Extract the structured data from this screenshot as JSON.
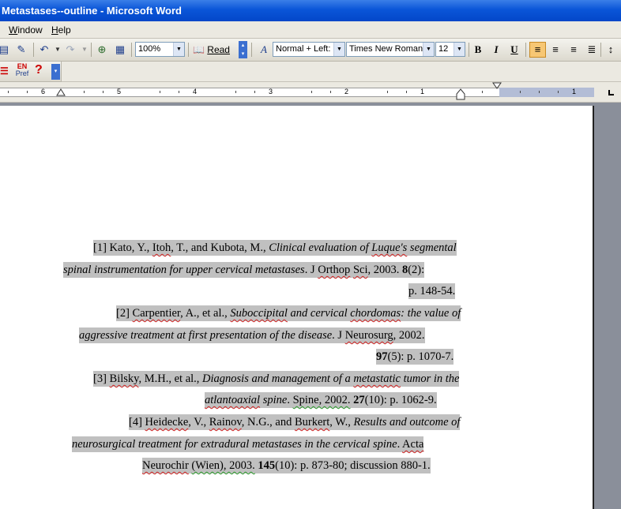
{
  "window": {
    "title": "Metastases--outline - Microsoft Word"
  },
  "menu": {
    "items": [
      "Window",
      "Help"
    ],
    "accel": [
      "W",
      "H"
    ]
  },
  "toolbar": {
    "zoom": "100%",
    "read_label": "Read",
    "style": "Normal + Left:",
    "font": "Times New Roman",
    "size": "12",
    "bold": "B",
    "italic": "I",
    "underline": "U"
  },
  "toolbar2": {
    "lang_top": "EN",
    "lang_bottom": "Pref",
    "help": "?"
  },
  "ruler": {
    "numbers": [
      "6",
      "5",
      "4",
      "3",
      "2",
      "1",
      "1"
    ]
  },
  "references": [
    {
      "lines": [
        [
          {
            "t": "[1] Kato, Y., "
          },
          {
            "t": "Itoh",
            "s": "wavy"
          },
          {
            "t": ", T., and Kubota, M., "
          },
          {
            "t": "Clinical evaluation of ",
            "i": true
          },
          {
            "t": "Luque's",
            "i": true,
            "s": "wavy"
          },
          {
            "t": " segmental",
            "i": true
          }
        ],
        [
          {
            "t": "spinal instrumentation for upper cervical metastases",
            "i": true
          },
          {
            "t": ". J "
          },
          {
            "t": "Orthop",
            "s": "wavy"
          },
          {
            "t": " "
          },
          {
            "t": "Sci",
            "s": "wavy"
          },
          {
            "t": ", 2003. "
          },
          {
            "t": "8",
            "b": true
          },
          {
            "t": "(2):"
          }
        ],
        [
          {
            "t": "p. 148-54."
          }
        ]
      ]
    },
    {
      "lines": [
        [
          {
            "t": "[2] "
          },
          {
            "t": "Carpentier",
            "s": "wavy"
          },
          {
            "t": ", A., et al., "
          },
          {
            "t": "Suboccipital",
            "i": true,
            "s": "wavy"
          },
          {
            "t": " and cervical ",
            "i": true
          },
          {
            "t": "chordomas",
            "i": true,
            "s": "wavy"
          },
          {
            "t": ": the value of",
            "i": true
          }
        ],
        [
          {
            "t": "aggressive treatment at first presentation of the disease",
            "i": true
          },
          {
            "t": ". J "
          },
          {
            "t": "Neurosurg",
            "s": "wavy"
          },
          {
            "t": ", 2002."
          }
        ],
        [
          {
            "t": "97",
            "b": true
          },
          {
            "t": "(5): p. 1070-7."
          }
        ]
      ]
    },
    {
      "lines": [
        [
          {
            "t": "[3] "
          },
          {
            "t": "Bilsky",
            "s": "wavy"
          },
          {
            "t": ", M.H., et al., "
          },
          {
            "t": "Diagnosis and management of a ",
            "i": true
          },
          {
            "t": "metastatic",
            "i": true,
            "s": "wavy"
          },
          {
            "t": " tumor in the",
            "i": true
          }
        ],
        [
          {
            "t": "atlantoaxial",
            "i": true,
            "s": "wavy"
          },
          {
            "t": " spine",
            "i": true
          },
          {
            "t": ". "
          },
          {
            "t": "Spine, 2002.",
            "s": "wavyg"
          },
          {
            "t": " "
          },
          {
            "t": "27",
            "b": true
          },
          {
            "t": "(10): p. 1062-9."
          }
        ]
      ]
    },
    {
      "lines": [
        [
          {
            "t": "[4] "
          },
          {
            "t": "Heidecke",
            "s": "wavy"
          },
          {
            "t": ", V., "
          },
          {
            "t": "Rainov",
            "s": "wavy"
          },
          {
            "t": ", N.G., and "
          },
          {
            "t": "Burkert",
            "s": "wavy"
          },
          {
            "t": ", W., "
          },
          {
            "t": "Results and outcome of",
            "i": true
          }
        ],
        [
          {
            "t": "neurosurgical treatment for extradural metastases in the cervical spine",
            "i": true
          },
          {
            "t": ". "
          },
          {
            "t": "Acta",
            "s": "wavy"
          }
        ],
        [
          {
            "t": "Neurochir",
            "s": "wavy"
          },
          {
            "t": " "
          },
          {
            "t": "(Wien), 2003.",
            "s": "wavyg"
          },
          {
            "t": " "
          },
          {
            "t": "145",
            "b": true
          },
          {
            "t": "(10): p. 873-80; discussion 880-1."
          }
        ]
      ]
    }
  ],
  "colors": {
    "titlebar": "#0a55d8",
    "highlight": "#c0c0c0",
    "spell_underline": "#d02020",
    "grammar_underline": "#2a9a2a"
  }
}
